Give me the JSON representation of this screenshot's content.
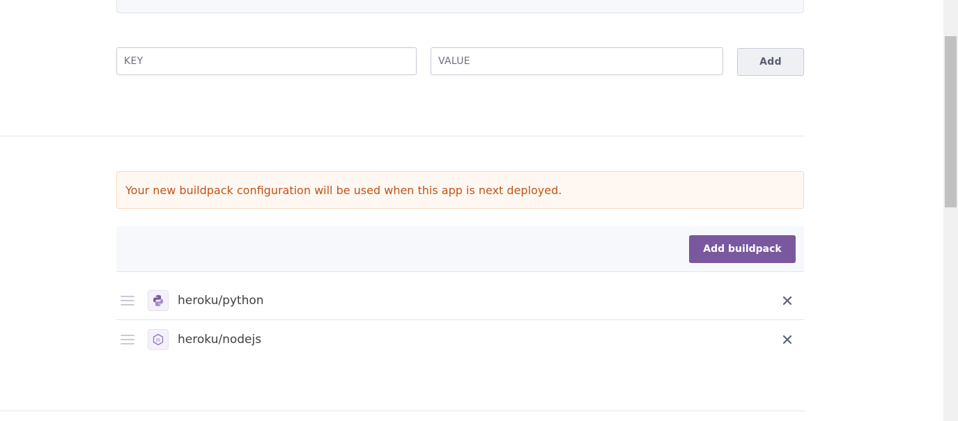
{
  "config_vars": {
    "key_placeholder": "KEY",
    "value_placeholder": "VALUE",
    "add_label": "Add"
  },
  "buildpacks": {
    "notice": "Your new buildpack configuration will be used when this app is next deployed.",
    "add_buildpack_label": "Add buildpack",
    "items": [
      {
        "name": "heroku/python",
        "icon": "python-icon"
      },
      {
        "name": "heroku/nodejs",
        "icon": "nodejs-icon"
      }
    ]
  },
  "colors": {
    "accent": "#79589f",
    "notice_text": "#c1531b",
    "notice_bg": "#fff8f2"
  }
}
